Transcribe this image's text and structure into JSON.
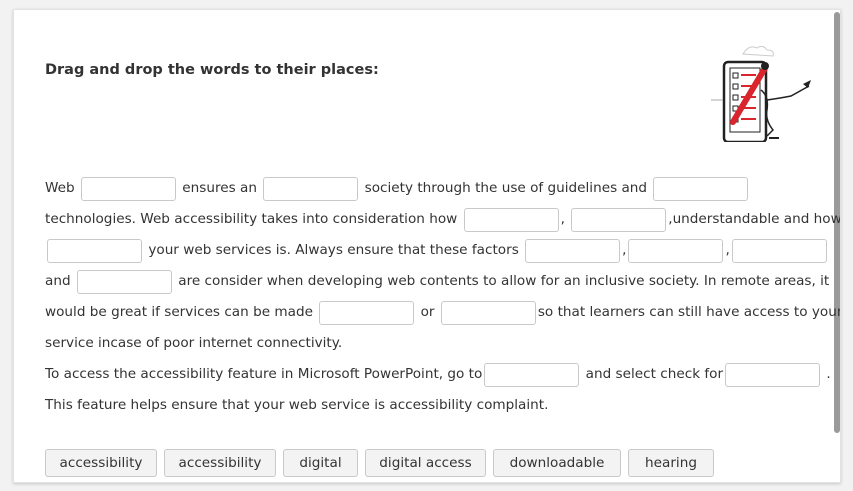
{
  "title": "Drag and drop the words to their places:",
  "sentences": {
    "l1_a": "Web",
    "l1_b": "ensures an",
    "l1_c": "society through the use of guidelines and",
    "l2_a": "technologies. Web accessibility takes into consideration how",
    "l2_b": ",",
    "l2_c": ",understandable and how",
    "l3_a": "your web services is. Always ensure that these factors",
    "l3_b": ",",
    "l3_c": ",",
    "l4_a": "and",
    "l4_b": "are consider when developing web contents to allow for an inclusive society. In remote areas, it",
    "l5_a": "would be great if services can be made",
    "l5_b": "or",
    "l5_c": "so that learners can still have access to your",
    "l6_a": "service incase of poor internet connectivity.",
    "l7_a": "To access the accessibility feature in Microsoft PowerPoint, go to",
    "l7_b": "and select check for",
    "l7_c": ".",
    "l8_a": "This feature helps ensure that your web service is accessibility complaint."
  },
  "word_bank": [
    "accessibility",
    "accessibility",
    "digital",
    "digital access",
    "downloadable",
    "hearing"
  ],
  "colors": {
    "accent_red": "#d9262c"
  }
}
